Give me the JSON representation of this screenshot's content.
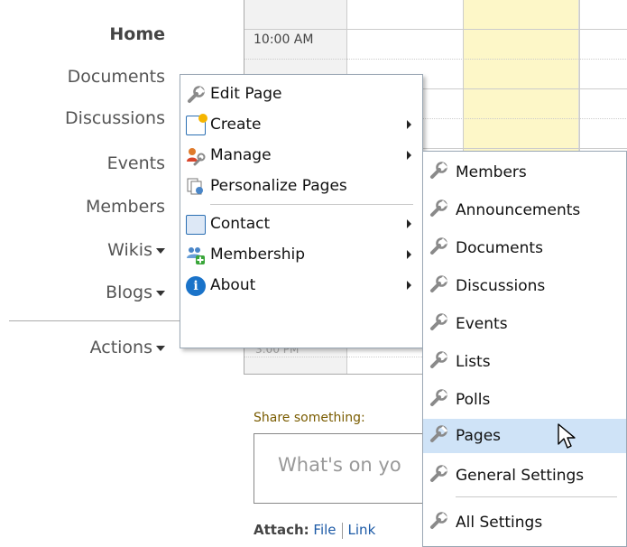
{
  "nav": {
    "home": "Home",
    "documents": "Documents",
    "discussions": "Discussions",
    "events": "Events",
    "members": "Members",
    "wikis": "Wikis",
    "blogs": "Blogs",
    "actions": "Actions"
  },
  "calendar": {
    "time_label": "10:00 AM",
    "time_frag": "3:00 PM"
  },
  "share": {
    "label": "Share something:",
    "placeholder": "What's on yo"
  },
  "attach": {
    "label": "Attach:",
    "file": "File",
    "link": "Link"
  },
  "menu": {
    "items": [
      {
        "label": "Edit Page",
        "icon": "wrench-icon",
        "submenu": false
      },
      {
        "label": "Create",
        "icon": "create-icon",
        "submenu": true
      },
      {
        "label": "Manage",
        "icon": "manage-icon",
        "submenu": true
      },
      {
        "label": "Personalize Pages",
        "icon": "personalize-icon",
        "submenu": false
      },
      {
        "label": "Contact",
        "icon": "contact-card-icon",
        "submenu": true
      },
      {
        "label": "Membership",
        "icon": "membership-icon",
        "submenu": true
      },
      {
        "label": "About",
        "icon": "info-icon",
        "submenu": true
      }
    ]
  },
  "submenu": {
    "items": [
      {
        "label": "Members"
      },
      {
        "label": "Announcements"
      },
      {
        "label": "Documents"
      },
      {
        "label": "Discussions"
      },
      {
        "label": "Events"
      },
      {
        "label": "Lists"
      },
      {
        "label": "Polls"
      },
      {
        "label": "Pages",
        "highlighted": true
      },
      {
        "label": "General Settings"
      },
      {
        "label": "All Settings"
      }
    ]
  },
  "colors": {
    "highlight": "#cfe3f7",
    "today_column": "#fdf7c8",
    "link": "#1c5aa6"
  }
}
